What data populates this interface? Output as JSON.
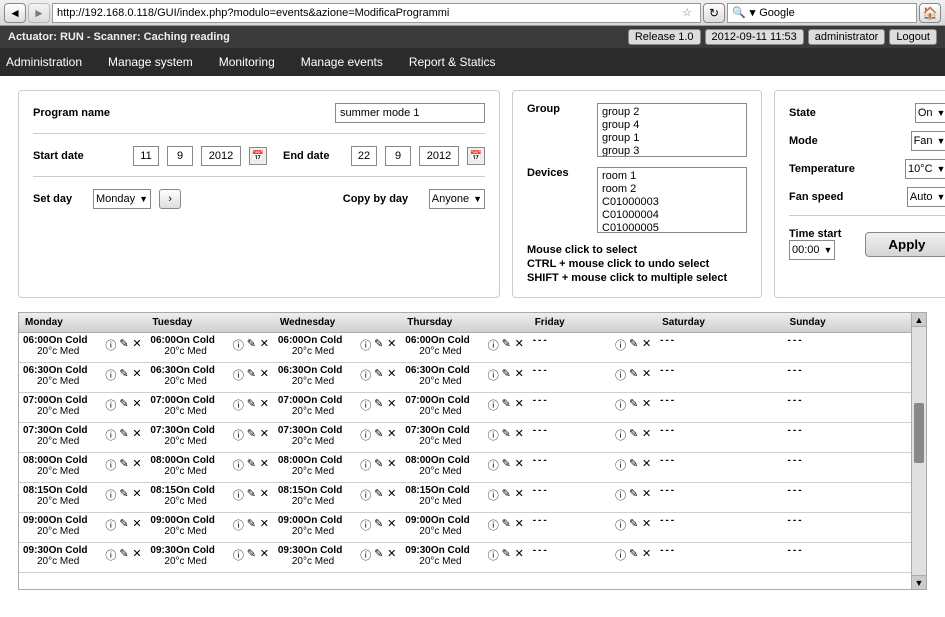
{
  "browser": {
    "url": "http://192.168.0.118/GUI/index.php?modulo=events&azione=ModificaProgrammi",
    "search_engine": "Google"
  },
  "status": {
    "left": "Actuator: RUN - Scanner: Caching reading",
    "release": "Release 1.0",
    "datetime": "2012-09-11 11:53",
    "user": "administrator",
    "logout": "Logout"
  },
  "menu": [
    "Administration",
    "Manage system",
    "Monitoring",
    "Manage events",
    "Report & Statics"
  ],
  "left": {
    "program_label": "Program name",
    "program_value": "summer mode 1",
    "start_label": "Start date",
    "start_d": "11",
    "start_m": "9",
    "start_y": "2012",
    "end_label": "End date",
    "end_d": "22",
    "end_m": "9",
    "end_y": "2012",
    "setday_label": "Set day",
    "setday_value": "Monday",
    "copy_label": "Copy by day",
    "copy_value": "Anyone"
  },
  "mid": {
    "group_label": "Group",
    "groups": [
      "group 2",
      "group 4",
      "group 1",
      "group 3"
    ],
    "devices_label": "Devices",
    "devices": [
      "room 1",
      "room 2",
      "C01000003",
      "C01000004",
      "C01000005"
    ],
    "hint1": "Mouse click to select",
    "hint2": "CTRL + mouse click to undo select",
    "hint3": "SHIFT + mouse click to multiple select"
  },
  "right": {
    "state_label": "State",
    "state_value": "On",
    "mode_label": "Mode",
    "mode_value": "Fan",
    "temp_label": "Temperature",
    "temp_value": "10°C",
    "fan_label": "Fan speed",
    "fan_value": "Auto",
    "time_label": "Time start",
    "time_value": "00:00",
    "apply": "Apply"
  },
  "sched": {
    "days": [
      "Monday",
      "Tuesday",
      "Wednesday",
      "Thursday",
      "Friday",
      "Saturday",
      "Sunday"
    ],
    "times": [
      "06:00",
      "06:30",
      "07:00",
      "07:30",
      "08:00",
      "08:15",
      "09:00",
      "09:30"
    ],
    "line_suffix": "On Cold",
    "line2": "20°c Med",
    "empty": "---"
  }
}
